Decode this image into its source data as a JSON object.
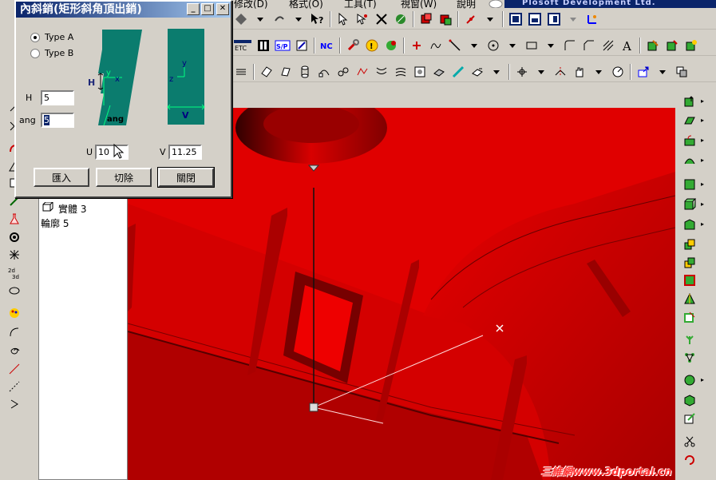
{
  "menubar": {
    "items": [
      "修改(D)",
      "格式(O)",
      "工具(T)",
      "視窗(W)",
      "說明"
    ],
    "brand": "Plosoft Development Ltd."
  },
  "dialog": {
    "title": "內斜銷(矩形斜角頂出銷)",
    "type_a": "Type A",
    "type_b": "Type B",
    "selected_type": "Type A",
    "h_label": "H",
    "h_value": "5",
    "ang_label": "ang",
    "ang_value": "5",
    "u_label": "U",
    "u_value": "10",
    "v_label": "V",
    "v_value": "11.25",
    "diagram": {
      "h": "H",
      "y1": "y",
      "x1": "x",
      "ang": "ang",
      "y2": "y",
      "z2": "z",
      "v": "V"
    },
    "buttons": {
      "import": "匯入",
      "delete": "切除",
      "close": "關閉"
    },
    "controls": {
      "minimize": "_",
      "maximize": "□",
      "close": "✕"
    }
  },
  "tree": {
    "items": [
      "實體 3",
      "輪廓 5"
    ]
  },
  "toolbar": {
    "etc": "ETC",
    "sp": "S/P",
    "nc": "NC",
    "a": "A"
  },
  "watermark": "三維網www.3dportal.cn",
  "colors": {
    "viewport": "#cc0000",
    "dialog_title": "#0a246a",
    "diagram_teal": "#0b7c6e"
  }
}
